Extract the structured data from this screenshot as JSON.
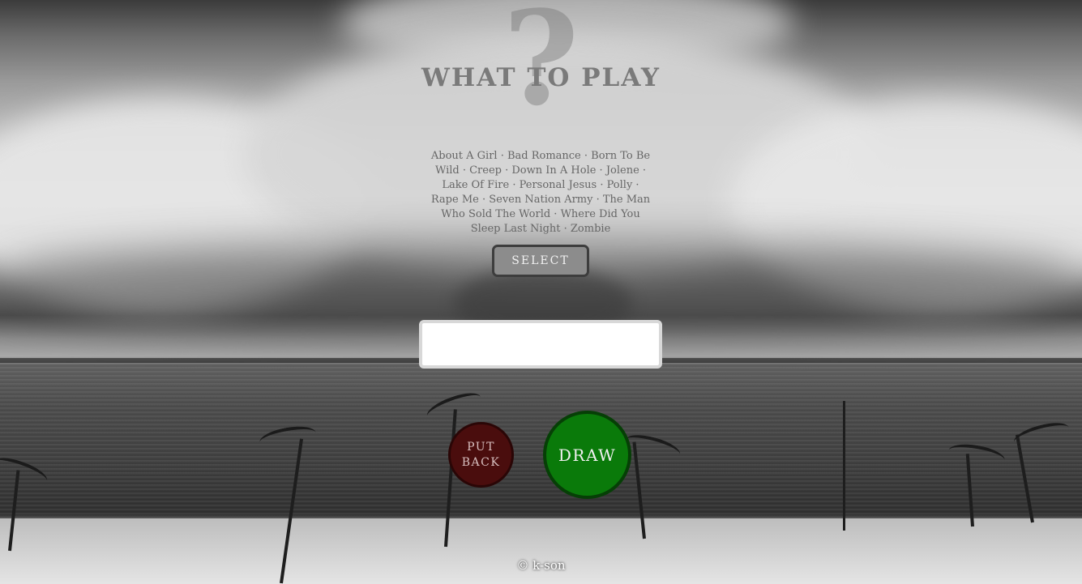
{
  "header": {
    "decorative_mark": "?",
    "title": "WHAT TO PLAY"
  },
  "songs": {
    "list_text": "About A Girl · Bad Romance · Born To Be Wild · Creep · Down In A Hole · Jolene · Lake Of Fire · Personal Jesus · Polly · Rape Me · Seven Nation Army · The Man Who Sold The World · Where Did You Sleep Last Night · Zombie"
  },
  "controls": {
    "select_label": "SELECT",
    "result_value": "",
    "putback_label": "PUT BACK",
    "draw_label": "DRAW"
  },
  "footer": {
    "copyright": "© k-son"
  },
  "colors": {
    "putback_bg": "#4a0d0d",
    "draw_bg": "#0a7a0a",
    "select_bg": "#8c8c8c"
  }
}
